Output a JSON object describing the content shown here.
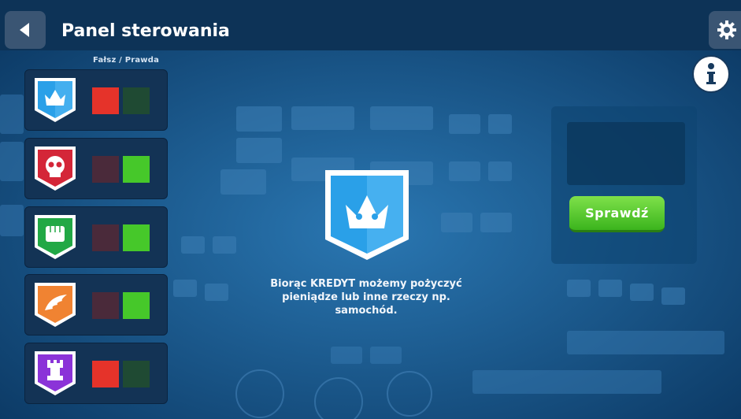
{
  "header": {
    "title": "Panel sterowania",
    "back_icon": "arrow-left-icon",
    "settings_icon": "gear-icon",
    "info_icon": "info-icon"
  },
  "column_header": "Fałsz / Prawda",
  "colors": {
    "false_active": "#e5332a",
    "false_inactive": "#4a2a3a",
    "true_active": "#46c82a",
    "true_inactive": "#1f4a33",
    "confirm_button": "#4cc52a"
  },
  "categories": [
    {
      "icon": "crown-icon",
      "color": "#2aa0e8",
      "answer": "false"
    },
    {
      "icon": "skull-icon",
      "color": "#d42638",
      "answer": "true"
    },
    {
      "icon": "fist-icon",
      "color": "#22a845",
      "answer": "true"
    },
    {
      "icon": "wing-icon",
      "color": "#f08332",
      "answer": "true"
    },
    {
      "icon": "tower-icon",
      "color": "#8b33d8",
      "answer": "false"
    }
  ],
  "question": {
    "icon": "crown-icon",
    "text": "Biorąc KREDYT możemy pożyczyć pieniądze lub inne rzeczy np. samochód."
  },
  "check_button": "Sprawdź"
}
